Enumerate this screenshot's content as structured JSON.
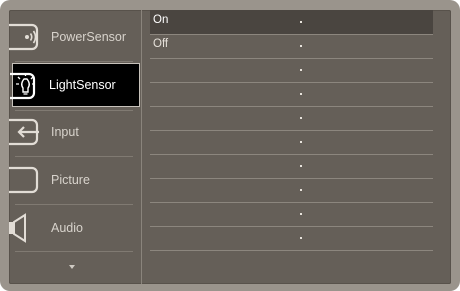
{
  "menu": {
    "items": [
      {
        "label": "PowerSensor",
        "icon": "power-sensor-icon",
        "selected": false
      },
      {
        "label": "LightSensor",
        "icon": "light-sensor-icon",
        "selected": true
      },
      {
        "label": "Input",
        "icon": "input-icon",
        "selected": false
      },
      {
        "label": "Picture",
        "icon": "picture-icon",
        "selected": false
      },
      {
        "label": "Audio",
        "icon": "audio-icon",
        "selected": false
      }
    ],
    "more_icon": "chevron-down-icon"
  },
  "options": {
    "items": [
      {
        "label": "On",
        "selected": true
      },
      {
        "label": "Off",
        "selected": false
      },
      {
        "label": "",
        "selected": false
      },
      {
        "label": "",
        "selected": false
      },
      {
        "label": "",
        "selected": false
      },
      {
        "label": "",
        "selected": false
      },
      {
        "label": "",
        "selected": false
      },
      {
        "label": "",
        "selected": false
      },
      {
        "label": "",
        "selected": false
      },
      {
        "label": "",
        "selected": false
      }
    ]
  },
  "colors": {
    "bezel": "#9a948c",
    "panel": "#655f58",
    "selected_menu_bg": "#000000",
    "selected_option_bg": "#4a4540",
    "text": "#d8d3cc"
  }
}
